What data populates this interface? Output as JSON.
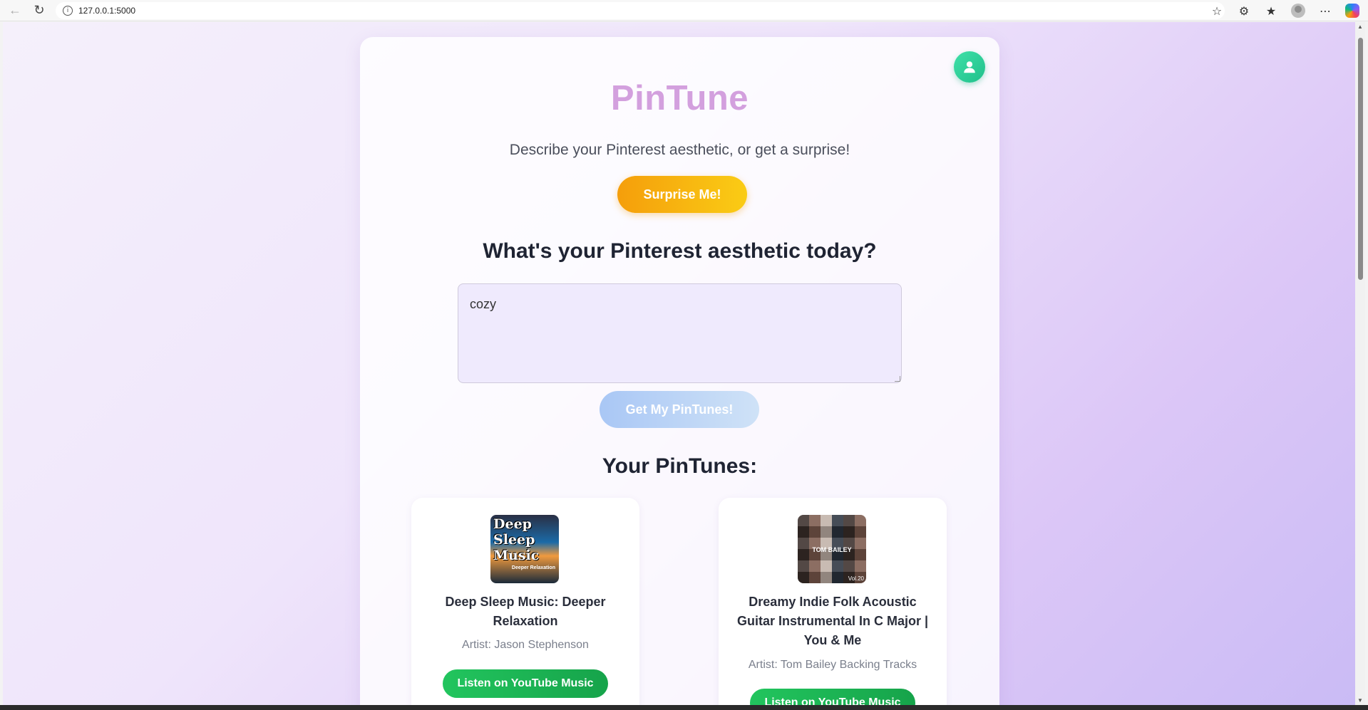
{
  "browser": {
    "url": "127.0.0.1:5000"
  },
  "app": {
    "title": "PinTune",
    "subtitle": "Describe your Pinterest aesthetic, or get a surprise!",
    "surprise_label": "Surprise Me!",
    "question": "What's your Pinterest aesthetic today?",
    "input_value": "cozy",
    "submit_label": "Get My PinTunes!",
    "results_title": "Your PinTunes:"
  },
  "results": [
    {
      "title": "Deep Sleep Music: Deeper Relaxation",
      "artist": "Artist: Jason Stephenson",
      "button": "Listen on YouTube Music",
      "cover_text": [
        "Deep",
        "Sleep",
        "Music"
      ],
      "cover_sub": "Deeper Relaxation"
    },
    {
      "title": "Dreamy Indie Folk Acoustic Guitar Instrumental In C Major | You & Me",
      "artist": "Artist: Tom Bailey Backing Tracks",
      "button": "Listen on YouTube Music",
      "cover_text": "TOM BAILEY",
      "cover_vol": "Vol.20"
    }
  ],
  "colors": {
    "title": "#d3a0de",
    "surprise": "#f59e0b",
    "submit": "#a9c7f5",
    "youtube_button": "#22c55e",
    "avatar": "#3ee0a8"
  }
}
